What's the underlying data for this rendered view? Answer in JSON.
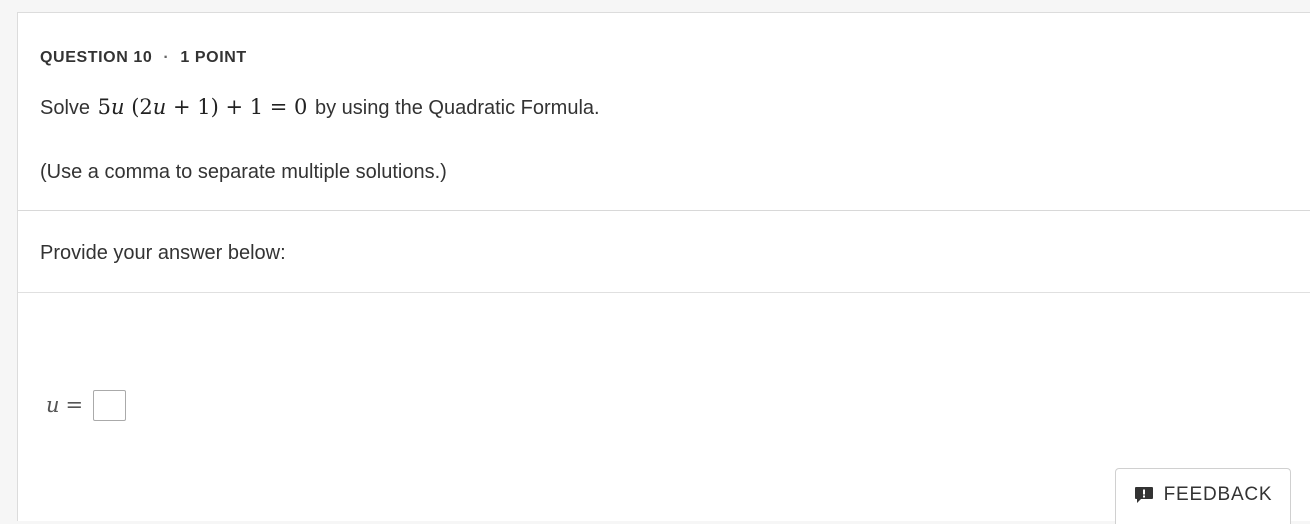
{
  "question": {
    "number_label": "QUESTION 10",
    "separator": "·",
    "points_label": "1 POINT",
    "prompt_prefix": "Solve",
    "prompt_suffix": "by using the Quadratic Formula.",
    "equation": {
      "coef": "5",
      "var": "u",
      "inner": "(2",
      "inner_var": "u",
      "inner_rest": "+ 1) + 1 = 0"
    },
    "note": "(Use a comma to separate multiple solutions.)"
  },
  "answer_section": {
    "label": "Provide your answer below:",
    "variable": "u",
    "equals": "=",
    "input_value": ""
  },
  "feedback": {
    "label": "FEEDBACK",
    "icon": "feedback-speech-icon"
  }
}
